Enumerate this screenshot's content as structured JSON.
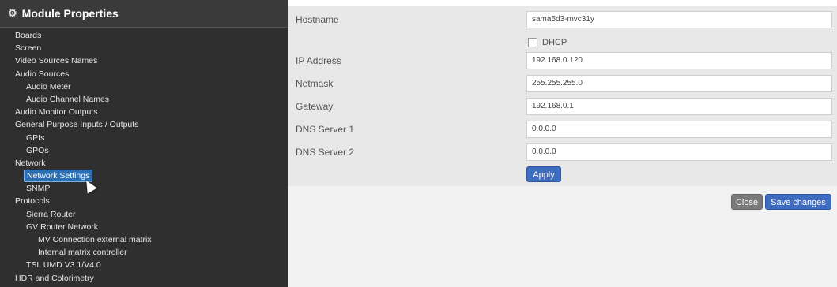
{
  "sidebar": {
    "title": "Module Properties",
    "header_icon": "gears-icon",
    "items": [
      {
        "label": "Boards",
        "level": 0
      },
      {
        "label": "Screen",
        "level": 0
      },
      {
        "label": "Video Sources Names",
        "level": 0
      },
      {
        "label": "Audio Sources",
        "level": 0
      },
      {
        "label": "Audio Meter",
        "level": 1
      },
      {
        "label": "Audio Channel Names",
        "level": 1
      },
      {
        "label": "Audio Monitor Outputs",
        "level": 0
      },
      {
        "label": "General Purpose Inputs / Outputs",
        "level": 0
      },
      {
        "label": "GPIs",
        "level": 1
      },
      {
        "label": "GPOs",
        "level": 1
      },
      {
        "label": "Network",
        "level": 0
      },
      {
        "label": "Network Settings",
        "level": 1,
        "selected": true
      },
      {
        "label": "SNMP",
        "level": 1
      },
      {
        "label": "Protocols",
        "level": 0
      },
      {
        "label": "Sierra Router",
        "level": 1
      },
      {
        "label": "GV Router Network",
        "level": 1
      },
      {
        "label": "MV Connection external matrix",
        "level": 2
      },
      {
        "label": "Internal matrix controller",
        "level": 2
      },
      {
        "label": "TSL UMD V3.1/V4.0",
        "level": 1
      },
      {
        "label": "HDR and Colorimetry",
        "level": 0
      }
    ]
  },
  "form": {
    "hostname": {
      "label": "Hostname",
      "value": "sama5d3-mvc31y"
    },
    "dhcp": {
      "label": "DHCP",
      "checked": false
    },
    "ip_address": {
      "label": "IP Address",
      "value": "192.168.0.120"
    },
    "netmask": {
      "label": "Netmask",
      "value": "255.255.255.0"
    },
    "gateway": {
      "label": "Gateway",
      "value": "192.168.0.1"
    },
    "dns1": {
      "label": "DNS Server 1",
      "value": "0.0.0.0"
    },
    "dns2": {
      "label": "DNS Server 2",
      "value": "0.0.0.0"
    },
    "apply_label": "Apply"
  },
  "footer": {
    "close_label": "Close",
    "save_label": "Save changes"
  },
  "colors": {
    "sidebar_bg": "#2f2f2f",
    "selected": "#2a6fb4",
    "primary_button": "#3d6cc0",
    "close_button": "#7a7a7a"
  }
}
